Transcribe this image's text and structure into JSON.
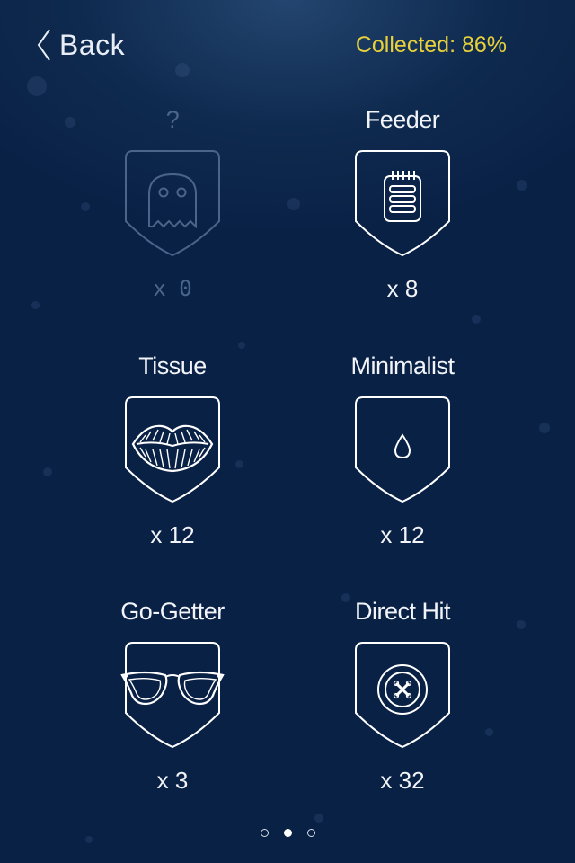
{
  "header": {
    "back_label": "Back",
    "collected_text": "Collected: 86%"
  },
  "colors": {
    "background": "#0f2a4f",
    "accent_yellow": "#e8d13a",
    "icon_stroke": "#ffffff",
    "locked": "#4a6589"
  },
  "badges": [
    {
      "title": "?",
      "count": "x 0",
      "icon": "ghost-icon",
      "locked": true
    },
    {
      "title": "Feeder",
      "count": "x 8",
      "icon": "notepad-icon",
      "locked": false
    },
    {
      "title": "Tissue",
      "count": "x 12",
      "icon": "lips-icon",
      "locked": false
    },
    {
      "title": "Minimalist",
      "count": "x 12",
      "icon": "droplet-icon",
      "locked": false
    },
    {
      "title": "Go-Getter",
      "count": "x 3",
      "icon": "cat-eye-glasses-icon",
      "locked": false
    },
    {
      "title": "Direct Hit",
      "count": "x 32",
      "icon": "button-cross-icon",
      "locked": false
    }
  ],
  "pager": {
    "pages": 3,
    "current": 2
  }
}
